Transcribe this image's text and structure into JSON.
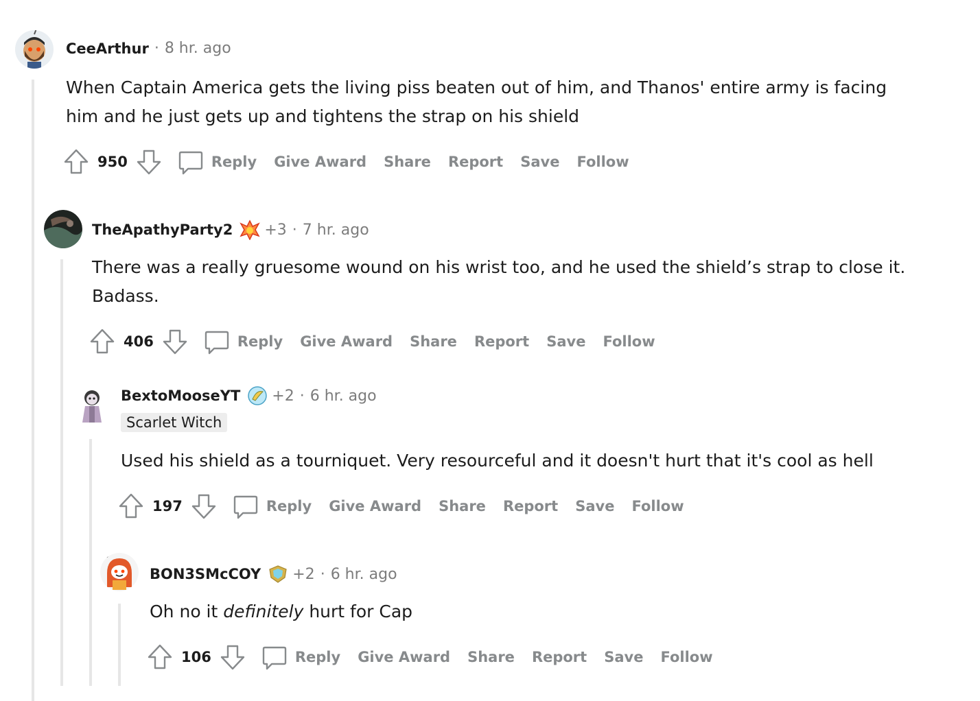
{
  "comments": [
    {
      "username": "CeeArthur",
      "time": "8 hr. ago",
      "body_lines": [
        "When Captain America gets the living piss beaten out of him, and Thanos' entire army is facing",
        "him and he just gets up and tightens the strap on his shield"
      ],
      "score": "950"
    },
    {
      "username": "TheApathyParty2",
      "award_count": "+3",
      "time": "7 hr. ago",
      "body_lines": [
        "There was a really gruesome wound on his wrist too, and he used the shield’s strap to close it.",
        "Badass."
      ],
      "score": "406"
    },
    {
      "username": "BextoMooseYT",
      "award_count": "+2",
      "time": "6 hr. ago",
      "flair": "Scarlet Witch",
      "body_lines": [
        "Used his shield as a tourniquet. Very resourceful and it doesn't hurt that it's cool as hell"
      ],
      "score": "197"
    },
    {
      "username": "BON3SMcCOY",
      "award_count": "+2",
      "time": "6 hr. ago",
      "body_before": "Oh no it ",
      "body_em": "definitely",
      "body_after": " hurt for Cap",
      "score": "106"
    }
  ],
  "actions": {
    "reply": "Reply",
    "give_award": "Give Award",
    "share": "Share",
    "report": "Report",
    "save": "Save",
    "follow": "Follow"
  },
  "icons": {
    "upvote": "upvote-arrow-icon",
    "downvote": "downvote-arrow-icon",
    "reply": "speech-bubble-icon"
  },
  "colors": {
    "action_gray": "#878a8c",
    "meta_gray": "#7c7c7c",
    "thread_line": "#e6e6e6",
    "flair_bg": "#ededed"
  }
}
